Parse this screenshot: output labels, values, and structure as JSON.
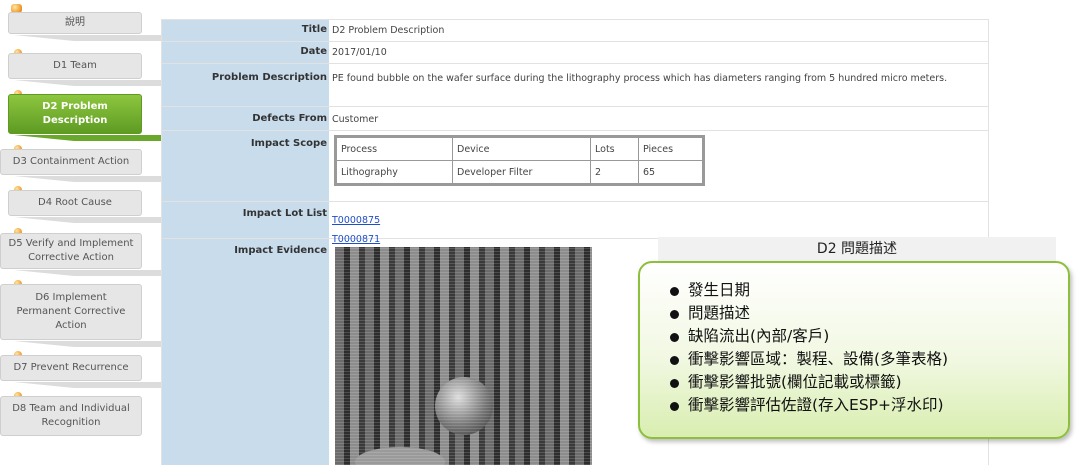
{
  "sidebar": {
    "items": [
      {
        "label": "說明",
        "active": false
      },
      {
        "label": "D1 Team",
        "active": false
      },
      {
        "label": "D2 Problem Description",
        "active": true
      },
      {
        "label": "D3 Containment Action",
        "active": false
      },
      {
        "label": "D4 Root Cause",
        "active": false
      },
      {
        "label": "D5 Verify and Implement Corrective Action",
        "active": false
      },
      {
        "label": "D6 Implement Permanent Corrective Action",
        "active": false
      },
      {
        "label": "D7 Prevent Recurrence",
        "active": false
      },
      {
        "label": "D8 Team and Individual Recognition",
        "active": false
      }
    ]
  },
  "form": {
    "title": {
      "label": "Title",
      "value": "D2 Problem Description"
    },
    "date": {
      "label": "Date",
      "value": "2017/01/10"
    },
    "problem": {
      "label": "Problem Description",
      "value": "PE found bubble on the wafer surface during the lithography process which has diameters ranging from 5 hundred micro meters."
    },
    "defects_from": {
      "label": "Defects From",
      "value": "Customer"
    },
    "impact_scope": {
      "label": "Impact Scope",
      "headers": [
        "Process",
        "Device",
        "Lots",
        "Pieces"
      ],
      "row": [
        "Lithography",
        "Developer Filter",
        "2",
        "65"
      ]
    },
    "impact_lot_list": {
      "label": "Impact Lot List",
      "lots": [
        "T0000875",
        "T0000871"
      ]
    },
    "impact_evidence": {
      "label": "Impact Evidence"
    }
  },
  "callout": {
    "title": "D2 問題描述",
    "bullets": [
      "發生日期",
      "問題描述",
      "缺陷流出(內部/客戶)",
      "衝擊影響區域：製程、設備(多筆表格)",
      "衝擊影響批號(欄位記載或標籤)",
      "衝擊影響評估佐證(存入ESP+浮水印)"
    ]
  }
}
